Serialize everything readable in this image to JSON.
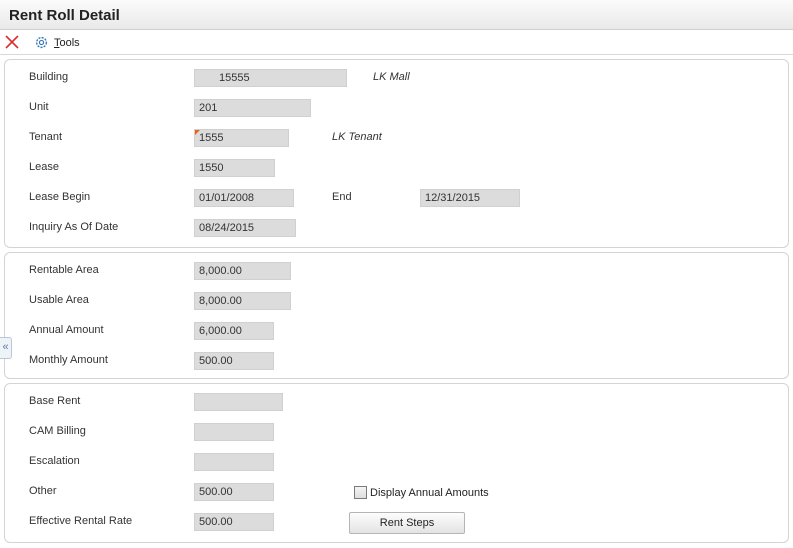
{
  "header": {
    "title": "Rent Roll Detail"
  },
  "toolbar": {
    "tools_label": "Tools"
  },
  "collapse_glyph": "«",
  "section1": {
    "building": {
      "label": "Building",
      "value": "15555",
      "desc": "LK Mall"
    },
    "unit": {
      "label": "Unit",
      "value": "201"
    },
    "tenant": {
      "label": "Tenant",
      "value": "1555",
      "desc": "LK Tenant"
    },
    "lease": {
      "label": "Lease",
      "value": "1550"
    },
    "lease_begin": {
      "label": "Lease Begin",
      "value": "01/01/2008"
    },
    "end": {
      "label": "End",
      "value": "12/31/2015"
    },
    "inquiry_date": {
      "label": "Inquiry As Of Date",
      "value": "08/24/2015"
    }
  },
  "section2": {
    "rentable_area": {
      "label": "Rentable Area",
      "value": "8,000.00"
    },
    "usable_area": {
      "label": "Usable Area",
      "value": "8,000.00"
    },
    "annual_amount": {
      "label": "Annual Amount",
      "value": "6,000.00"
    },
    "monthly_amount": {
      "label": "Monthly Amount",
      "value": "500.00"
    }
  },
  "section3": {
    "base_rent": {
      "label": "Base Rent",
      "value": ""
    },
    "cam_billing": {
      "label": "CAM Billing",
      "value": ""
    },
    "escalation": {
      "label": "Escalation",
      "value": ""
    },
    "other": {
      "label": "Other",
      "value": "500.00"
    },
    "effective_rate": {
      "label": "Effective Rental Rate",
      "value": "500.00"
    },
    "display_annual": {
      "label": "Display Annual Amounts",
      "checked": false
    },
    "rent_steps_label": "Rent Steps"
  },
  "colors": {
    "close": "#d9302c",
    "required": "#e8641b",
    "field_bg": "#dcdcdc",
    "gear": "#3a78b8"
  }
}
